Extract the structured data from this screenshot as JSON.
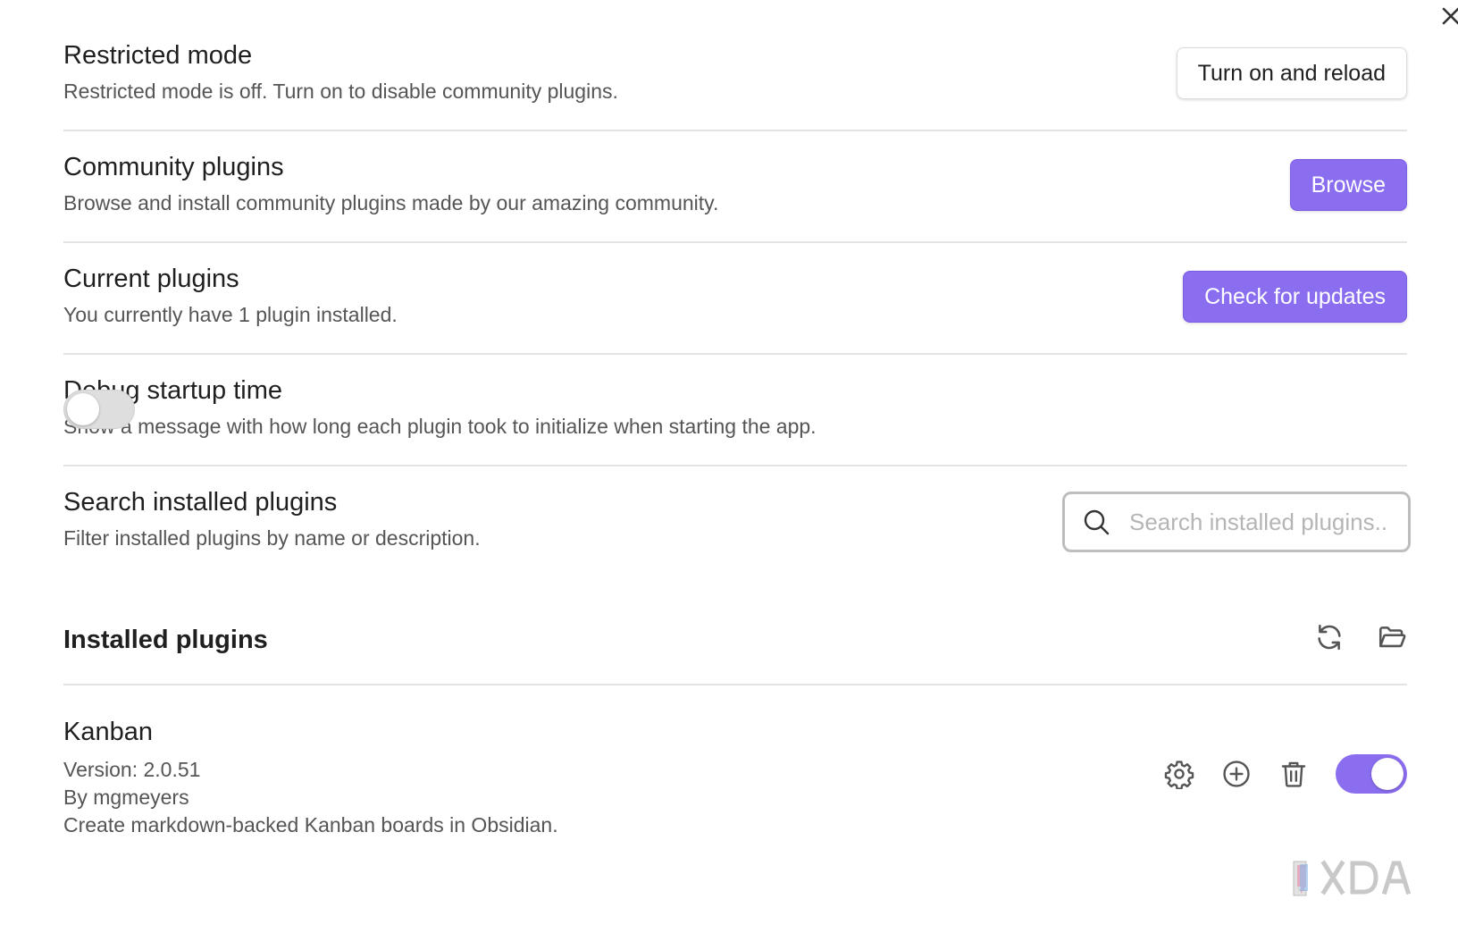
{
  "settings": {
    "restricted_mode": {
      "name": "Restricted mode",
      "desc": "Restricted mode is off. Turn on to disable community plugins.",
      "button": "Turn on and reload"
    },
    "community_plugins": {
      "name": "Community plugins",
      "desc": "Browse and install community plugins made by our amazing community.",
      "button": "Browse"
    },
    "current_plugins": {
      "name": "Current plugins",
      "desc": "You currently have 1 plugin installed.",
      "button": "Check for updates"
    },
    "debug_startup": {
      "name": "Debug startup time",
      "desc": "Show a message with how long each plugin took to initialize when starting the app.",
      "enabled": false
    },
    "search_installed": {
      "name": "Search installed plugins",
      "desc": "Filter installed plugins by name or description.",
      "placeholder": "Search installed plugins...",
      "value": ""
    }
  },
  "installed": {
    "heading": "Installed plugins",
    "icons": [
      "refresh-icon",
      "folder-open-icon"
    ],
    "plugins": [
      {
        "name": "Kanban",
        "version": "Version: 2.0.51",
        "author": "By mgmeyers",
        "description": "Create markdown-backed Kanban boards in Obsidian.",
        "enabled": true,
        "icons": [
          "gear-icon",
          "plus-circle-icon",
          "trash-icon"
        ]
      }
    ]
  },
  "colors": {
    "accent": "#8b6ef0",
    "divider": "#e3e3e3",
    "toggle_off": "#dedede"
  },
  "watermark": "XDA"
}
